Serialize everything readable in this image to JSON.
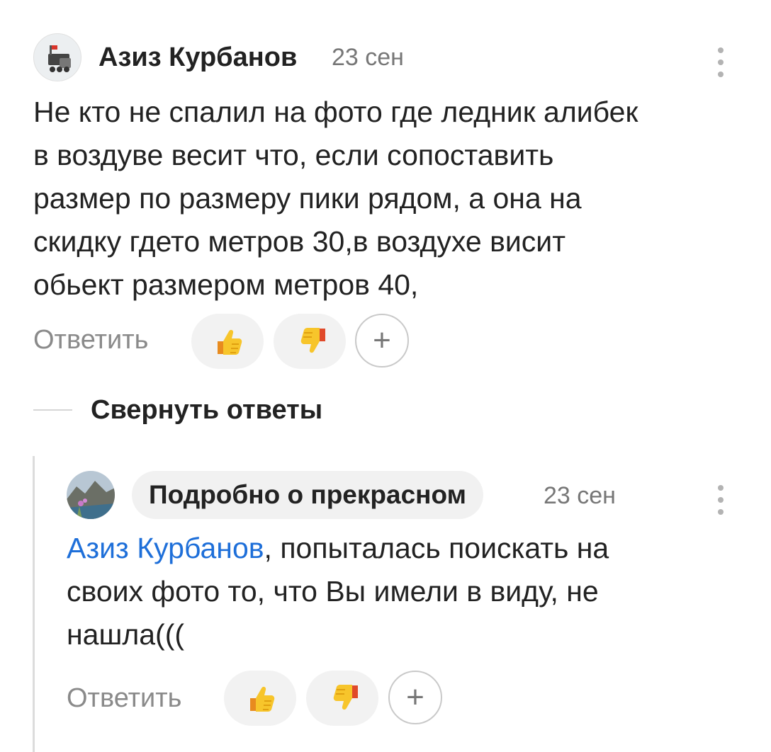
{
  "comments": [
    {
      "author": "Азиз Курбанов",
      "date": "23 сен",
      "text_lines": [
        "Не кто не спалил на фото где ледник алибек",
        "в воздуве весит что, если сопоставить",
        "размер по размеру пики рядом, а она на",
        "скидку гдето метров 30,в воздухе висит",
        "обьект размером метров 40,"
      ],
      "reply_label": "Ответить",
      "plus_label": "+"
    }
  ],
  "collapse_replies_label": "Свернуть ответы",
  "replies": [
    {
      "author": "Подробно о прекрасном",
      "date": "23 сен",
      "mention": "Азиз Курбанов",
      "text_lines": [
        ", попыталась поискать на",
        "своих фото то, что Вы имели в виду, не",
        "нашла((("
      ],
      "reply_label": "Ответить",
      "plus_label": "+"
    }
  ],
  "icons": {
    "like": "thumbs-up-icon",
    "dislike": "thumbs-down-icon",
    "menu": "more-vertical-icon"
  },
  "colors": {
    "mention": "#1e6fd9",
    "muted_text": "#8a8a8a",
    "chip_bg": "#f1f1f1"
  }
}
